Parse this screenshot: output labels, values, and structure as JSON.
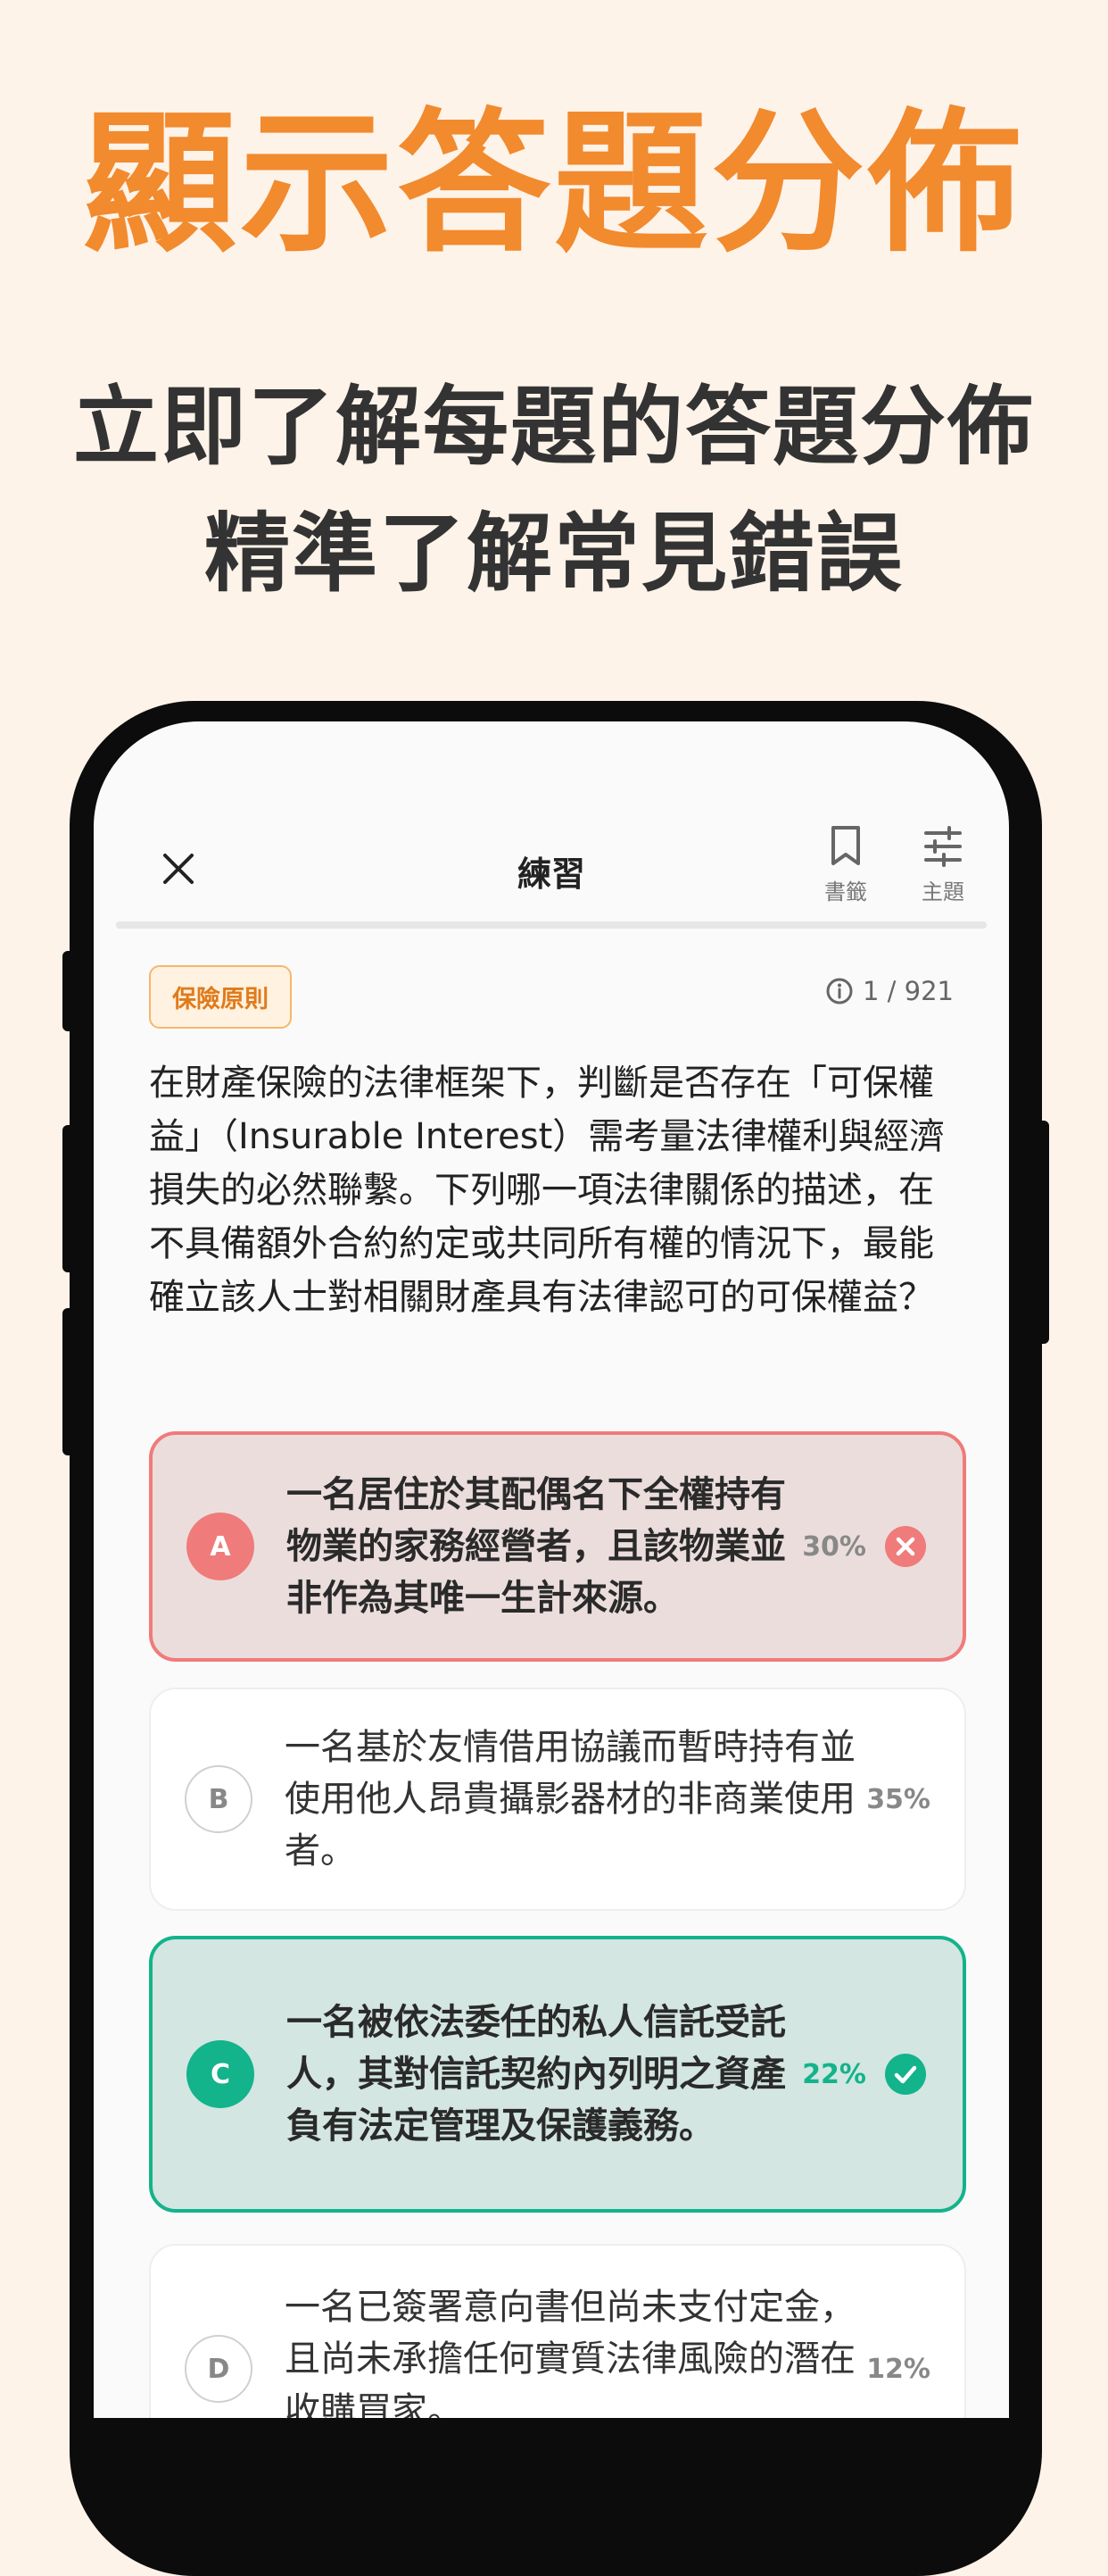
{
  "promo": {
    "headline": "顯示答題分佈",
    "subline_1": "立即了解每題的答題分佈",
    "subline_2": "精準了解常見錯誤"
  },
  "appbar": {
    "title": "練習",
    "bookmark_label": "書籤",
    "theme_label": "主題"
  },
  "progress_fraction": 1.0,
  "question": {
    "tag": "保險原則",
    "counter": "1 / 921",
    "text": "在財產保險的法律框架下，判斷是否存在「可保權益」（Insurable Interest）需考量法律權利與經濟損失的必然聯繫。下列哪一項法律關係的描述，在不具備額外合約約定或共同所有權的情況下，最能確立該人士對相關財產具有法律認可的可保權益？"
  },
  "options": [
    {
      "letter": "A",
      "text": "一名居住於其配偶名下全權持有物業的家務經營者，且該物業並非作為其唯一生計來源。",
      "percent": "30%",
      "state": "wrong"
    },
    {
      "letter": "B",
      "text": "一名基於友情借用協議而暫時持有並使用他人昂貴攝影器材的非商業使用者。",
      "percent": "35%",
      "state": "neutral"
    },
    {
      "letter": "C",
      "text": "一名被依法委任的私人信託受託人，其對信託契約內列明之資產負有法定管理及保護義務。",
      "percent": "22%",
      "state": "correct"
    },
    {
      "letter": "D",
      "text": "一名已簽署意向書但尚未支付定金，且尚未承擔任何實質法律風險的潛在收購買家。",
      "percent": "12%",
      "state": "neutral"
    }
  ],
  "colors": {
    "accent": "#f28a2e",
    "wrong": "#f07b7b",
    "correct": "#13b38b",
    "background": "#fdf3e9"
  }
}
